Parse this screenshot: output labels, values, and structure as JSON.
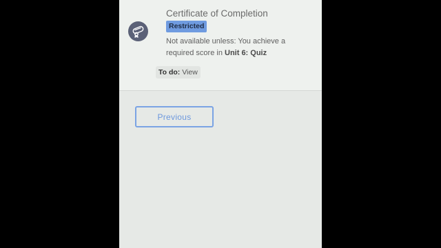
{
  "activity": {
    "icon": "certificate-icon",
    "title": "Certificate of Completion",
    "badge": "Restricted",
    "restriction_prefix": "Not available unless: You achieve a required score in ",
    "restriction_target": "Unit 6: Quiz",
    "todo_key": "To do:",
    "todo_value": "View"
  },
  "navigation": {
    "previous_label": "Previous"
  },
  "colors": {
    "badge_background": "#6f9be0",
    "button_border": "#7aa3e4",
    "icon_background": "#5b6177"
  }
}
